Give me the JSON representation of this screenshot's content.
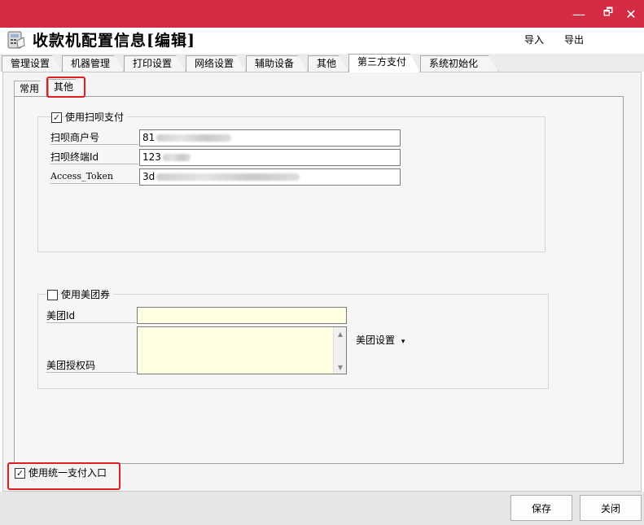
{
  "window": {
    "title": "收款机配置信息[编辑]",
    "minimize_glyph": "—",
    "restore_glyph": "🗗",
    "close_glyph": "✕",
    "accent": "#d42c45"
  },
  "header": {
    "import_label": "导入",
    "export_label": "导出"
  },
  "main_tabs": [
    {
      "label": "管理设置"
    },
    {
      "label": "机器管理"
    },
    {
      "label": "打印设置"
    },
    {
      "label": "网络设置"
    },
    {
      "label": "辅助设备"
    },
    {
      "label": "其他"
    },
    {
      "label": "第三方支付",
      "active": true
    },
    {
      "label": "系统初始化"
    }
  ],
  "sub_tabs": [
    {
      "label": "常用"
    },
    {
      "label": "其他",
      "active": true
    }
  ],
  "saobei": {
    "enable_label": "使用扫呗支付",
    "enabled": true,
    "fields": [
      {
        "label": "扫呗商户号",
        "value_prefix": "81"
      },
      {
        "label": "扫呗终端Id",
        "value_prefix": "123"
      },
      {
        "label": "Access_Token",
        "value_prefix": "3d"
      }
    ]
  },
  "meituan": {
    "enable_label": "使用美团券",
    "enabled": false,
    "id_label": "美团Id",
    "auth_label": "美团授权码",
    "settings_label": "美团设置",
    "settings_arrow": "▾"
  },
  "unified": {
    "label": "使用统一支付入口",
    "enabled": true
  },
  "footer": {
    "save_label": "保存",
    "close_label": "关闭"
  },
  "check_glyph": "✓"
}
